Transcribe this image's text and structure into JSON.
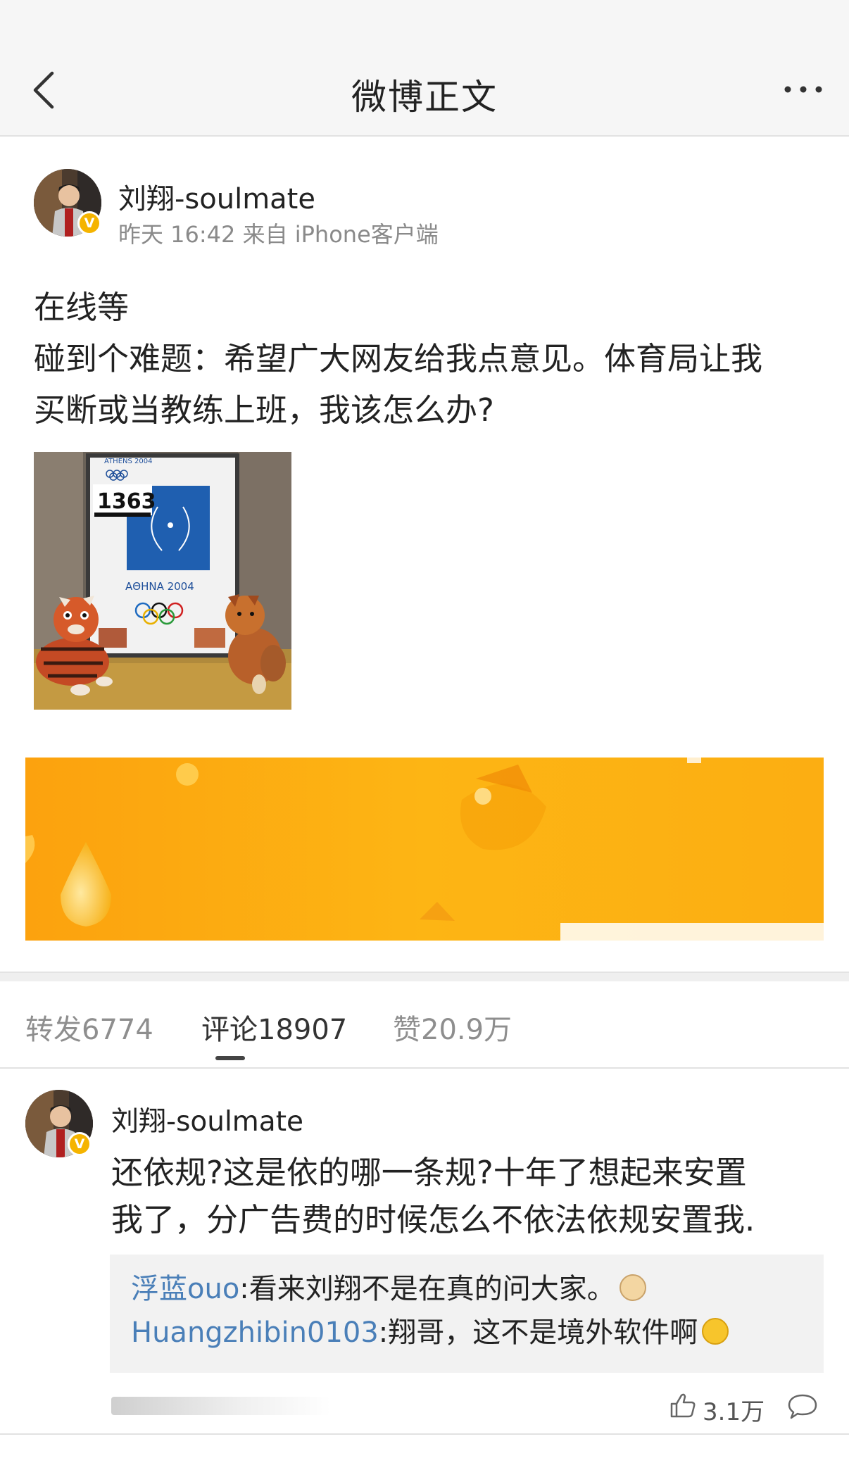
{
  "nav": {
    "title": "微博正文"
  },
  "post": {
    "author": "刘翔-soulmate",
    "meta": "昨天 16:42 来自 iPhone客户端",
    "text_lines": [
      "在线等",
      "碰到个难题：希望广大网友给我点意见。体育局让我",
      "买断或当教练上班，我该怎么办?"
    ],
    "image": {
      "top_label": "ATHENS 2004",
      "bib_number": "1363",
      "caption": "ΑΘΗΝΑ 2004"
    }
  },
  "tabs": [
    {
      "label": "转发6774"
    },
    {
      "label": "评论18907"
    },
    {
      "label": "赞20.9万"
    }
  ],
  "comment": {
    "author": "刘翔-soulmate",
    "text_lines": [
      "还依规?这是依的哪一条规?十年了想起来安置",
      "我了，分广告费的时候怎么不依法依规安置我."
    ],
    "replies": [
      {
        "user": "浮蓝ouo",
        "text": ":看来刘翔不是在真的问大家。"
      },
      {
        "user": "Huangzhibin0103",
        "text": ":翔哥，这不是境外软件啊"
      }
    ],
    "like_count": "3.1万"
  },
  "colors": {
    "link_blue": "#4a7fb8",
    "verified_badge": "#f5b400",
    "banner_orange": "#fdb10e"
  },
  "icons": {
    "back": "chevron-left-icon",
    "more": "ellipsis-icon",
    "like": "thumbs-up-icon",
    "comment": "speech-bubble-icon"
  }
}
